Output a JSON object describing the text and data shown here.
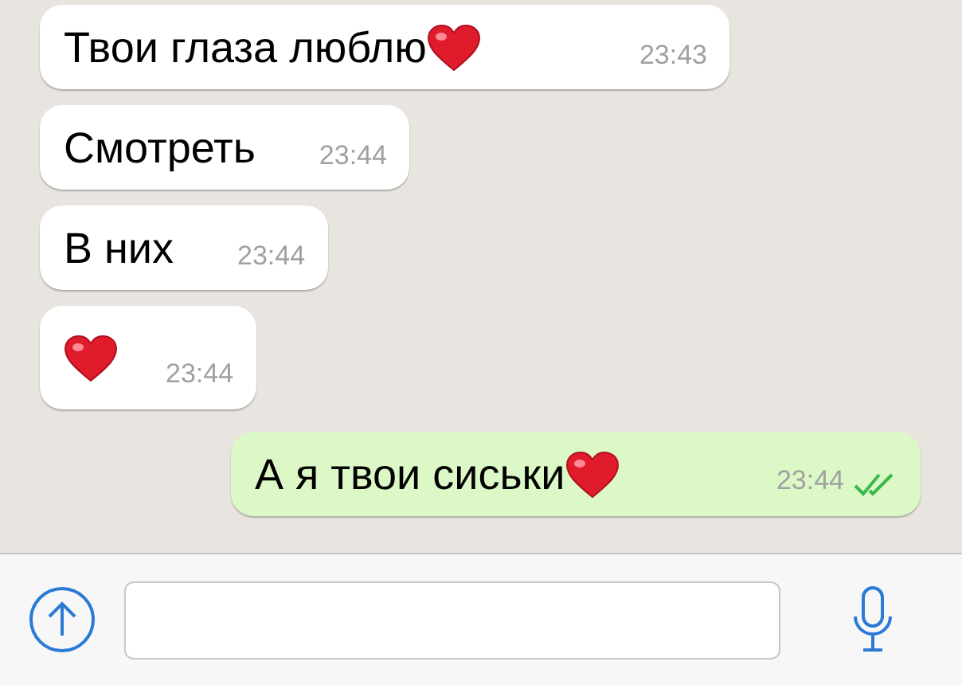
{
  "messages": [
    {
      "kind": "incoming",
      "text": "Твои глаза люблю",
      "heart": true,
      "time": "23:43"
    },
    {
      "kind": "incoming",
      "text": "Смотреть",
      "heart": false,
      "time": "23:44"
    },
    {
      "kind": "incoming",
      "text": "В них",
      "heart": false,
      "time": "23:44"
    },
    {
      "kind": "incoming",
      "heart": true,
      "time": "23:44"
    },
    {
      "kind": "outgoing",
      "text": "А я твои сиськи",
      "heart": true,
      "time": "23:44",
      "read": true
    }
  ]
}
